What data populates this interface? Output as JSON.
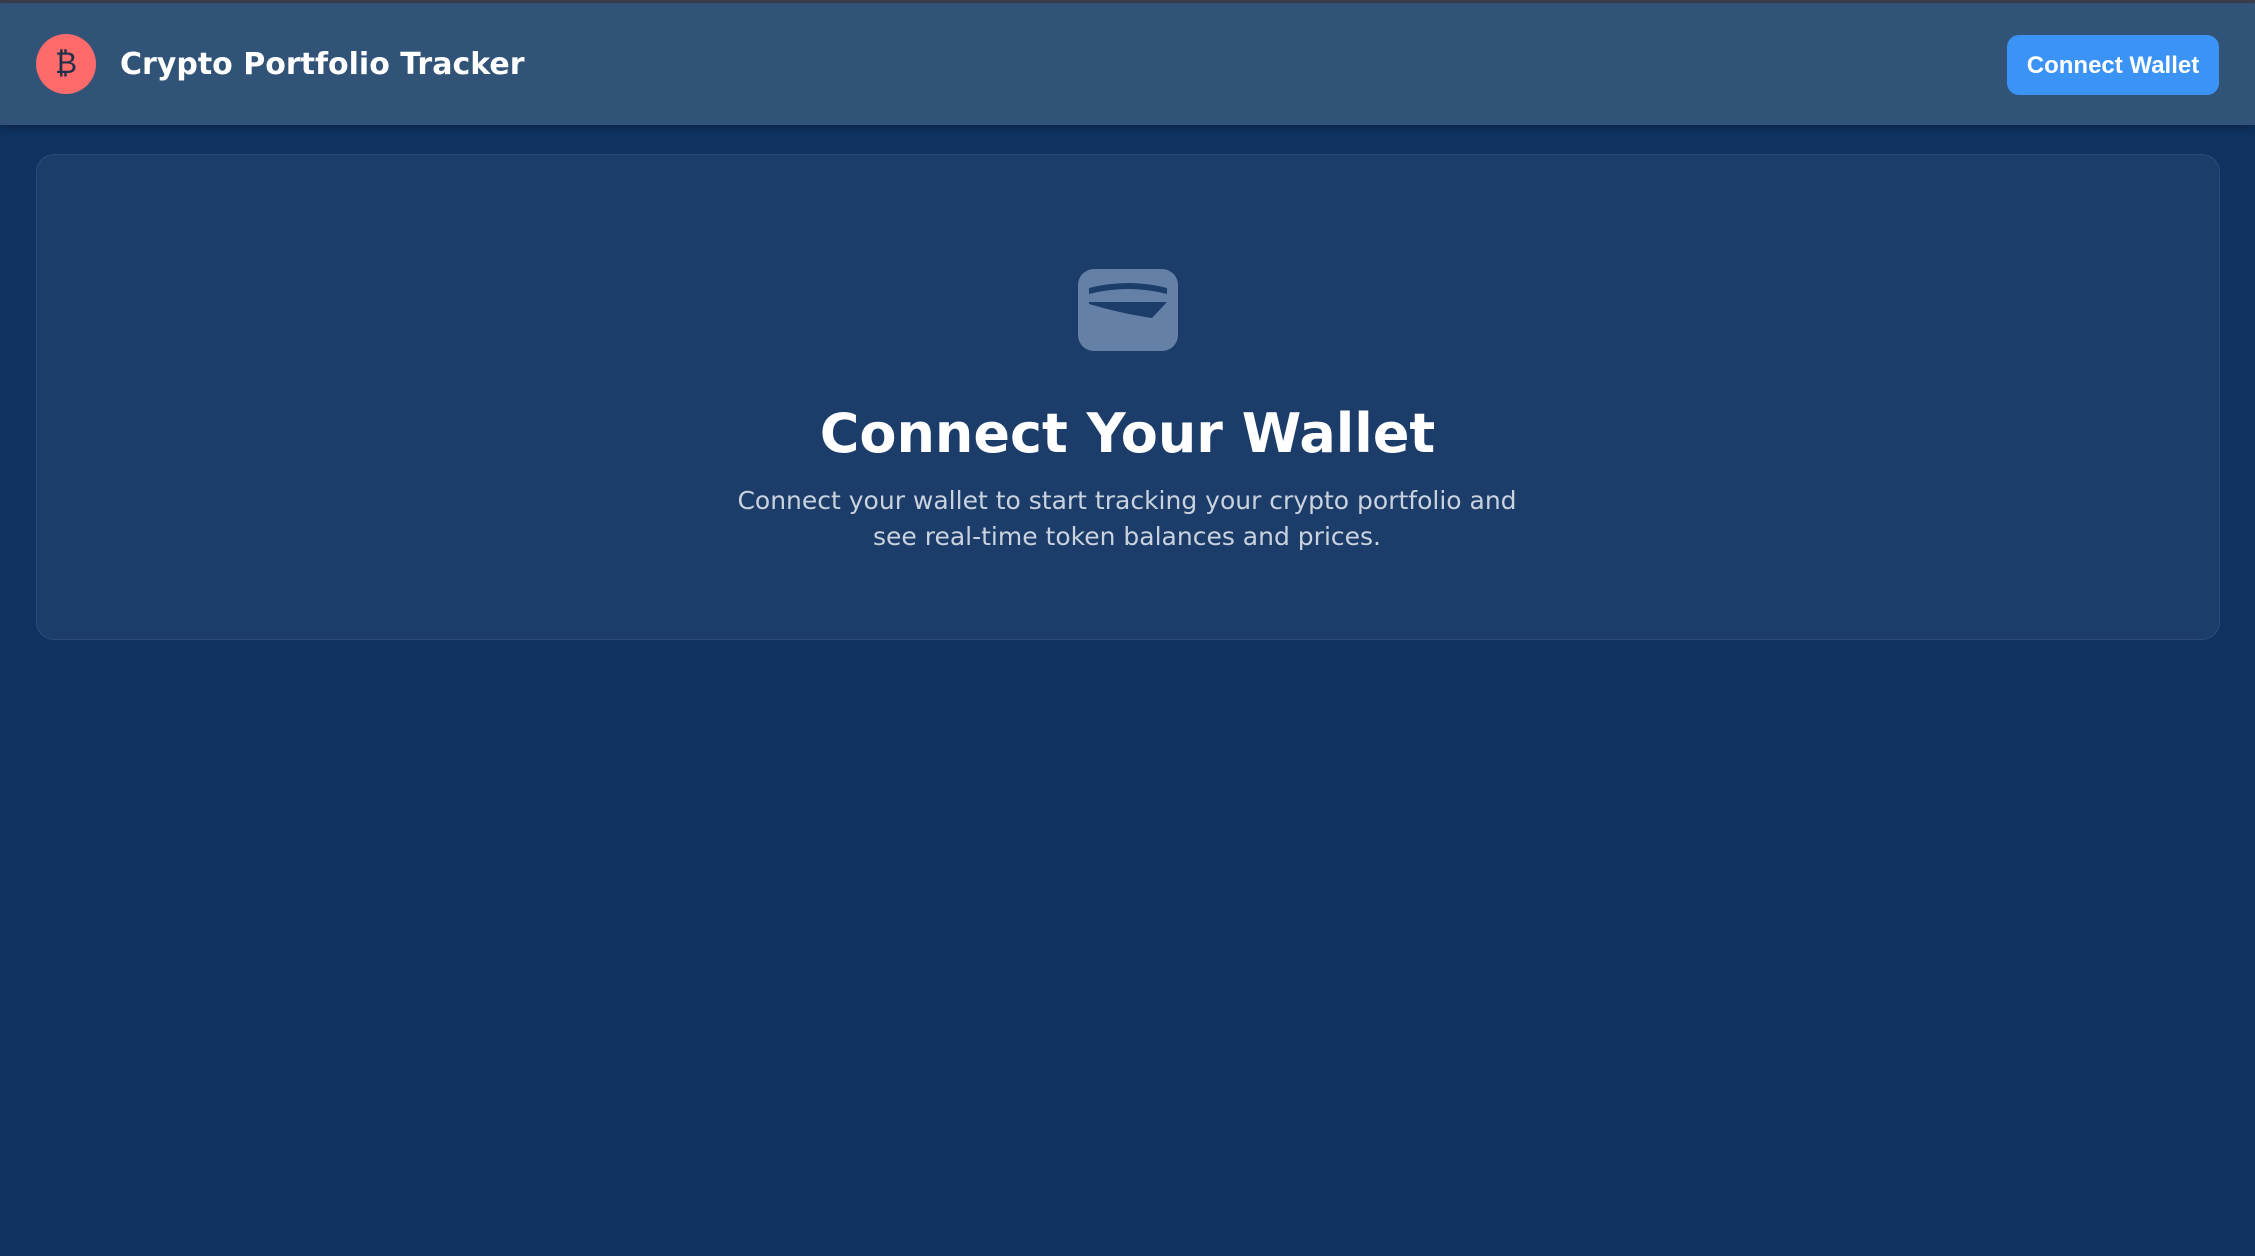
{
  "header": {
    "logo_symbol": "₿",
    "title": "Crypto Portfolio Tracker",
    "connect_button_label": "Connect Wallet"
  },
  "main": {
    "icon": "wallet-icon",
    "heading": "Connect Your Wallet",
    "description": "Connect your wallet to start tracking your crypto portfolio and see real-time token balances and prices."
  },
  "colors": {
    "background": "#0f3260",
    "header": "#325378",
    "card": "#1c3d69",
    "accent": "#3b93f6",
    "logo": "#ff6b6b"
  }
}
